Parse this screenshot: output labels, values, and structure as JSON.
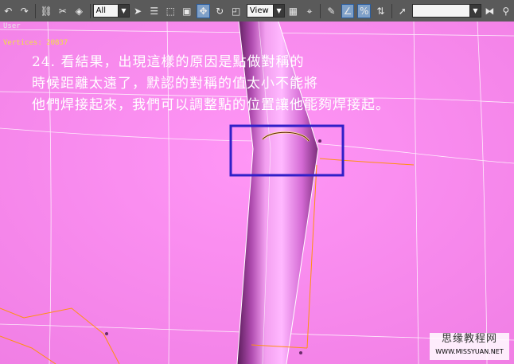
{
  "toolbar": {
    "selection_filter": "All",
    "reference_coord": "View"
  },
  "viewport": {
    "label": "User",
    "vertices_label": "Vertices: 20837"
  },
  "caption": {
    "line1": "24.  看結果，出現這樣的原因是點做對稱的",
    "line2": "時候距離太遠了，默認的對稱的值太小不能將",
    "line3": "他們焊接起來，我們可以調整點的位置讓他能夠焊接起。"
  },
  "watermark": {
    "line1": "思缘教程网",
    "line2": "WWW.MISSYUAN.NET"
  },
  "colors": {
    "viewport_bg": "#ff88f0",
    "highlight_box": "#3020c8",
    "toolbar_bg": "#5a5a5a"
  }
}
